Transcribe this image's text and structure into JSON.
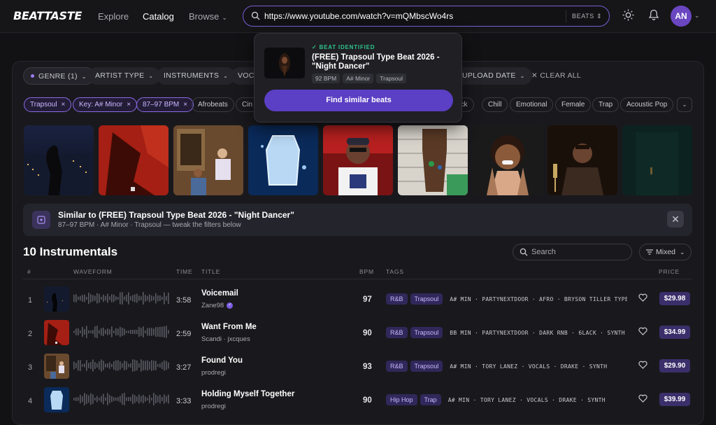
{
  "app": {
    "logo": "BEATTASTE"
  },
  "nav": [
    {
      "label": "Explore",
      "active": false
    },
    {
      "label": "Catalog",
      "active": true
    },
    {
      "label": "Browse",
      "active": false,
      "caret": "⌄"
    }
  ],
  "urlbar": {
    "value": "https://www.youtube.com/watch?v=mQMbscWo4rs",
    "scope": "BEATS",
    "scope_caret": "⇕"
  },
  "user": {
    "initials": "AN"
  },
  "filters": [
    {
      "label": "GENRE (1)",
      "caret": "⌄",
      "active": true
    },
    {
      "label": "ARTIST TYPE",
      "caret": "⌄"
    },
    {
      "label": "INSTRUMENTS",
      "caret": "⌄"
    },
    {
      "label": "VOC",
      "caret": ""
    },
    {
      "label": "UPLOAD DATE",
      "caret": "⌄"
    }
  ],
  "clear_all": "✕ CLEAR ALL",
  "tags": [
    {
      "label": "Trapsoul",
      "selected": true,
      "remove": "×"
    },
    {
      "label": "Key: A# Minor",
      "selected": true,
      "remove": "×"
    },
    {
      "label": "87–97 BPM",
      "selected": true,
      "remove": "×"
    },
    {
      "label": "Afrobeats"
    },
    {
      "label": "Cin"
    },
    {
      "label": "ock"
    },
    {
      "label": "Chill"
    },
    {
      "label": "Emotional"
    },
    {
      "label": "Female"
    },
    {
      "label": "Trap"
    },
    {
      "label": "Acoustic Pop"
    }
  ],
  "more_tags_icon": "chevron-down-icon",
  "popup": {
    "status": "✓ BEAT IDENTIFIED",
    "title": "(FREE) Trapsoul Type Beat 2026 - \"Night Dancer\"",
    "bpm": "92 BPM",
    "key": "A# Minor",
    "genre": "Trapsoul",
    "button": "Find similar beats"
  },
  "similar": {
    "title": "Similar to (FREE) Trapsoul Type Beat 2026 - \"Night Dancer\"",
    "subtitle": "87–97 BPM · A# Minor · Trapsoul — tweak the filters below",
    "close": "✕"
  },
  "list": {
    "count": "10 Instrumentals",
    "search_placeholder": "Search",
    "sort": "Mixed",
    "sort_caret": "⌄",
    "columns": {
      "num": "#",
      "waveform": "WAVEFORM",
      "time": "TIME",
      "title": "TITLE",
      "bpm": "BPM",
      "tags": "TAGS",
      "price": "PRICE"
    }
  },
  "tracks": [
    {
      "num": "1",
      "time": "3:58",
      "title": "Voicemail",
      "artist": "Zane98",
      "verified": "✓",
      "bpm": "97",
      "genres": [
        "R&B",
        "Trapsoul"
      ],
      "keywords": "A# MIN · PARTYNEXTDOOR · AFRO · BRYSON TILLER TYPE BEAT",
      "price": "$29.98"
    },
    {
      "num": "2",
      "time": "2:59",
      "title": "Want From Me",
      "artist": "Scandi · jxcques",
      "verified": "",
      "bpm": "90",
      "genres": [
        "R&B",
        "Trapsoul"
      ],
      "keywords": "BB MIN · PARTYNEXTDOOR · DARK RNB · 6LACK · SYNTH",
      "price": "$34.99"
    },
    {
      "num": "3",
      "time": "3:27",
      "title": "Found You",
      "artist": "prodregi",
      "verified": "",
      "bpm": "93",
      "genres": [
        "R&B",
        "Trapsoul"
      ],
      "keywords": "A# MIN · TORY LANEZ · VOCALS · DRAKE · SYNTH",
      "price": "$29.90"
    },
    {
      "num": "4",
      "time": "3:33",
      "title": "Holding Myself Together",
      "artist": "prodregi",
      "verified": "",
      "bpm": "90",
      "genres": [
        "Hip Hop",
        "Trap"
      ],
      "keywords": "A# MIN · TORY LANEZ · VOCALS · DRAKE · SYNTH",
      "price": "$39.99"
    }
  ],
  "colors": {
    "accent": "#7a5cd6",
    "button": "#5b3fc4",
    "price_bg": "#3b2f6b",
    "tag_bg": "#30285a",
    "success": "#2fc68a"
  }
}
